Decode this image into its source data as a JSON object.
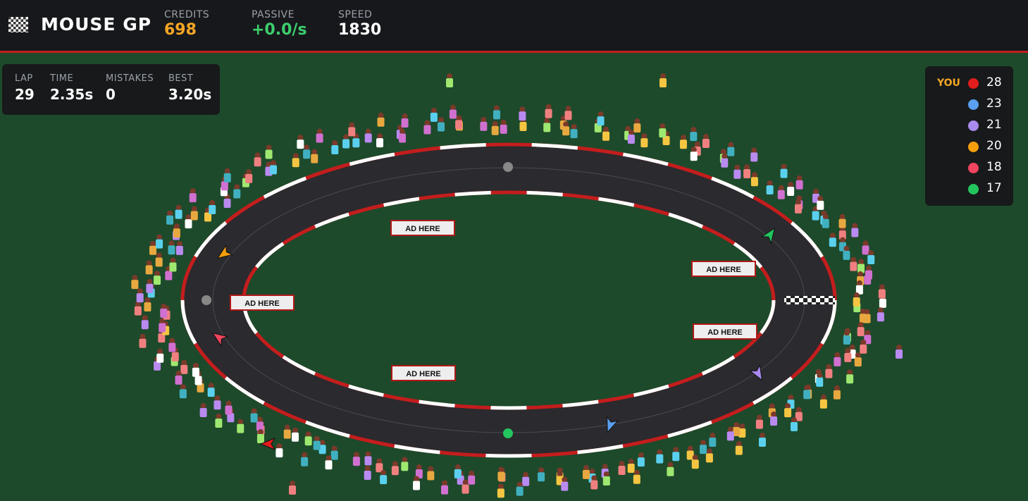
{
  "header": {
    "title": "MOUSE GP",
    "stats": [
      {
        "label": "CREDITS",
        "value": "698",
        "color": "#f5a623"
      },
      {
        "label": "PASSIVE",
        "value": "+0.0/s",
        "color": "#3ccf6d"
      },
      {
        "label": "SPEED",
        "value": "1830",
        "color": "#ffffff"
      }
    ]
  },
  "lap_panel": [
    {
      "label": "LAP",
      "value": "29"
    },
    {
      "label": "TIME",
      "value": "2.35s"
    },
    {
      "label": "MISTAKES",
      "value": "0"
    },
    {
      "label": "BEST",
      "value": "3.20s"
    }
  ],
  "standings": {
    "you_label": "YOU",
    "rows": [
      {
        "color": "#e11d1d",
        "score": "28",
        "you": true
      },
      {
        "color": "#5aa0ee",
        "score": "23"
      },
      {
        "color": "#a98aee",
        "score": "21"
      },
      {
        "color": "#f59e0b",
        "score": "20"
      },
      {
        "color": "#f0445f",
        "score": "18"
      },
      {
        "color": "#22c55e",
        "score": "17"
      }
    ]
  },
  "track": {
    "ad_text": "AD HERE",
    "colors": {
      "asphalt": "#2b2a2e",
      "curb_red": "#c41d1d",
      "curb_white": "#ffffff",
      "grass": "#1d4a2b"
    }
  },
  "cars": [
    {
      "color": "#f59e0b",
      "icon": "arrow-icon"
    },
    {
      "color": "#f0445f",
      "icon": "arrow-icon"
    },
    {
      "color": "#22c55e",
      "icon": "arrow-icon"
    },
    {
      "color": "#a98aee",
      "icon": "arrow-icon"
    },
    {
      "color": "#5aa0ee",
      "icon": "arrow-icon"
    },
    {
      "color": "#e11d1d",
      "icon": "arrow-icon"
    }
  ]
}
